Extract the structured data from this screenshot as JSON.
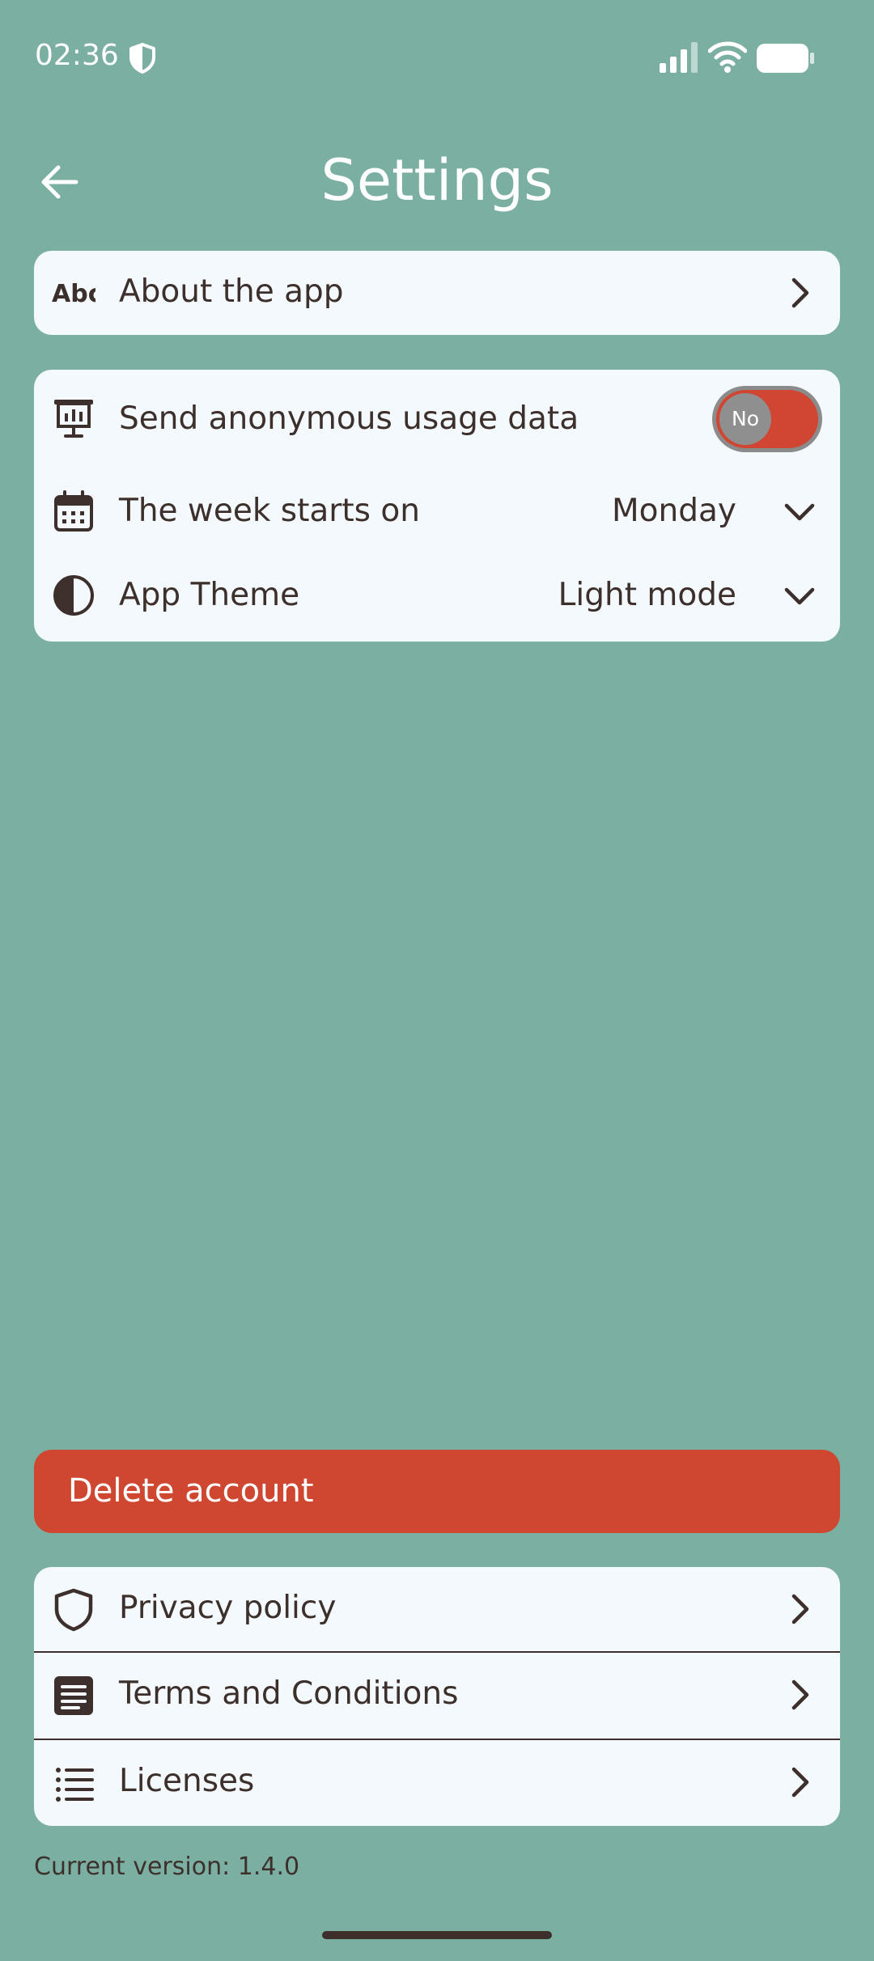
{
  "status_bar": {
    "time": "02:36",
    "icons": [
      "shield-icon",
      "signal-icon",
      "wifi-icon",
      "battery-icon"
    ],
    "color": "#ffffff"
  },
  "header": {
    "title": "Settings",
    "back_icon": "arrow-left-icon"
  },
  "about_card": {
    "label": "About the app",
    "icon": "abc-icon"
  },
  "preferences": {
    "usage_data": {
      "label": "Send anonymous usage data",
      "icon": "presentation-chart-icon",
      "toggle_text": "No",
      "enabled": false
    },
    "week_start": {
      "label": "The week starts on",
      "icon": "calendar-icon",
      "value": "Monday"
    },
    "theme": {
      "label": "App Theme",
      "icon": "contrast-icon",
      "value": "Light mode"
    }
  },
  "delete_account": {
    "label": "Delete account",
    "color": "#cf4631"
  },
  "legal": {
    "items": [
      {
        "label": "Privacy policy",
        "icon": "shield-outline-icon"
      },
      {
        "label": "Terms and Conditions",
        "icon": "document-lines-icon"
      },
      {
        "label": "Licenses",
        "icon": "list-icon"
      }
    ]
  },
  "footer": {
    "version": "Current version: 1.4.0"
  },
  "colors": {
    "background": "#7aafa2",
    "card": "#f3f9fc",
    "text": "#3d302c",
    "accent_red": "#cf4631"
  }
}
